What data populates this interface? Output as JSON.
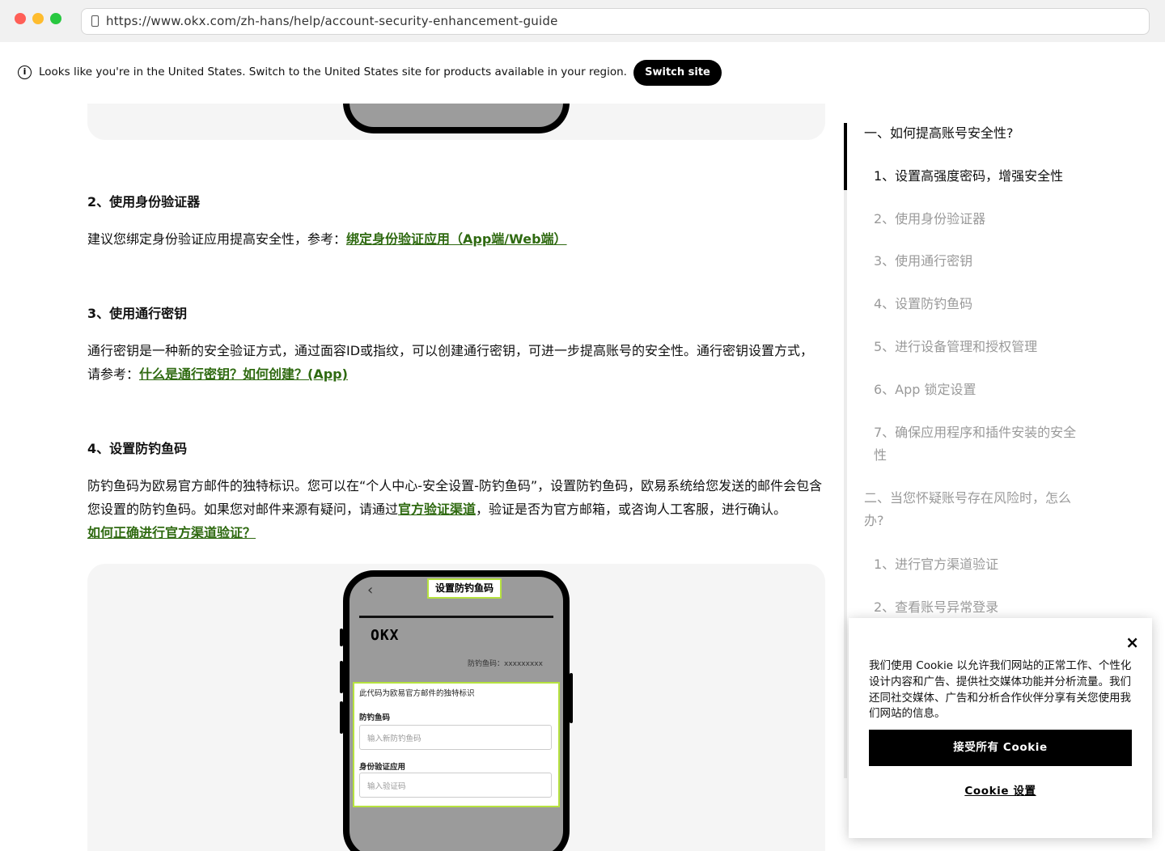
{
  "browser": {
    "url": "https://www.okx.com/zh-hans/help/account-security-enhancement-guide"
  },
  "banner": {
    "info_icon": "i",
    "message": "Looks like you're in the United States. Switch to the United States site for products available in your region.",
    "switch_label": "Switch site"
  },
  "article": {
    "section2": {
      "heading": "2、使用身份验证器",
      "text": "建议您绑定身份验证应用提高安全性，参考：",
      "link": "绑定身份验证应用（App端/Web端）"
    },
    "section3": {
      "heading": "3、使用通行密钥",
      "text": "通行密钥是一种新的安全验证方式，通过面容ID或指纹，可以创建通行密钥，可进一步提高账号的安全性。通行密钥设置方式，请参考：",
      "link": "什么是通行密钥？如何创建？(App)"
    },
    "section4": {
      "heading": "4、设置防钓鱼码",
      "text_part1": "防钓鱼码为欧易官方邮件的独特标识。您可以在“个人中心-安全设置-防钓鱼码”，设置防钓鱼码，欧易系统给您发送的邮件会包含您设置的防钓鱼码。如果您对邮件来源有疑问，请通过",
      "link_inline": "官方验证渠道",
      "text_part2": "，验证是否为官方邮箱，或咨询人工客服，进行确认。",
      "link_block": "如何正确进行官方渠道验证？"
    },
    "phone_mock": {
      "back": "‹",
      "title": "设置防钓鱼码",
      "logo": "OKX",
      "code_label": "防钓鱼码：xxxxxxxxx",
      "card_desc": "此代码为欧易官方邮件的独特标识",
      "field1_label": "防钓鱼码",
      "field1_placeholder": "输入新防钓鱼码",
      "field2_label": "身份验证应用",
      "field2_placeholder": "输入验证码"
    }
  },
  "toc": {
    "items": [
      {
        "label": "一、如何提高账号安全性?",
        "level": "top",
        "state": "active"
      },
      {
        "label": "1、设置高强度密码，增强安全性",
        "level": "sub",
        "state": "active"
      },
      {
        "label": "2、使用身份验证器",
        "level": "sub",
        "state": "inactive"
      },
      {
        "label": "3、使用通行密钥",
        "level": "sub",
        "state": "inactive"
      },
      {
        "label": "4、设置防钓鱼码",
        "level": "sub",
        "state": "inactive"
      },
      {
        "label": "5、进行设备管理和授权管理",
        "level": "sub",
        "state": "inactive"
      },
      {
        "label": "6、App 锁定设置",
        "level": "sub",
        "state": "inactive"
      },
      {
        "label": "7、确保应用程序和插件安装的安全性",
        "level": "sub",
        "state": "inactive"
      },
      {
        "label": "二、当您怀疑账号存在风险时，怎么办?",
        "level": "top",
        "state": "inactive"
      },
      {
        "label": "1、进行官方渠道验证",
        "level": "sub",
        "state": "inactive"
      },
      {
        "label": "2、查看账号异常登录",
        "level": "sub",
        "state": "inactive"
      }
    ]
  },
  "cookie": {
    "close": "×",
    "message": "我们使用 Cookie 以允许我们网站的正常工作、个性化设计内容和广告、提供社交媒体功能并分析流量。我们还同社交媒体、广告和分析合作伙伴分享有关您使用我们网站的信息。",
    "accept_label": "接受所有 Cookie",
    "settings_label": "Cookie 设置"
  },
  "colors": {
    "link": "#2f6a11",
    "highlight": "#b6e23f",
    "button": "#000000"
  }
}
